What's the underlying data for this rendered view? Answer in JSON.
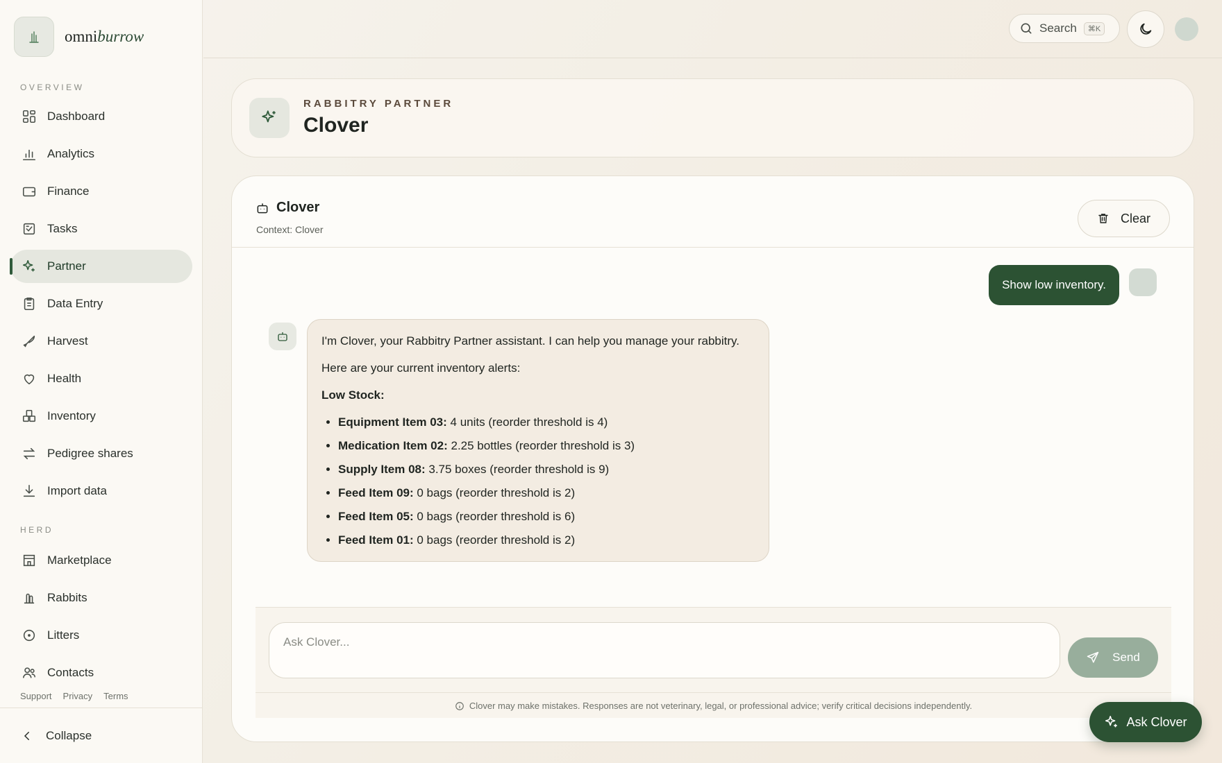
{
  "brand": {
    "name_part1": "omni",
    "name_part2": "burrow"
  },
  "sidebar": {
    "overview_label": "OVERVIEW",
    "herd_label": "HERD",
    "overview_items": [
      {
        "label": "Dashboard",
        "icon": "dashboard-icon"
      },
      {
        "label": "Analytics",
        "icon": "bar-chart-icon"
      },
      {
        "label": "Finance",
        "icon": "wallet-icon"
      },
      {
        "label": "Tasks",
        "icon": "checklist-icon"
      },
      {
        "label": "Partner",
        "icon": "sparkles-icon",
        "active": true
      },
      {
        "label": "Data Entry",
        "icon": "clipboard-icon"
      },
      {
        "label": "Harvest",
        "icon": "knife-icon"
      },
      {
        "label": "Health",
        "icon": "heart-icon"
      },
      {
        "label": "Inventory",
        "icon": "boxes-icon"
      },
      {
        "label": "Pedigree shares",
        "icon": "transfer-icon"
      },
      {
        "label": "Import data",
        "icon": "download-icon"
      }
    ],
    "herd_items": [
      {
        "label": "Marketplace",
        "icon": "store-icon"
      },
      {
        "label": "Rabbits",
        "icon": "rabbit-icon"
      },
      {
        "label": "Litters",
        "icon": "egg-icon"
      },
      {
        "label": "Contacts",
        "icon": "users-icon"
      }
    ],
    "footer_links": [
      "Support",
      "Privacy",
      "Terms"
    ],
    "collapse_label": "Collapse",
    "accent": "#2f5a3a"
  },
  "topbar": {
    "search_label": "Search",
    "search_shortcut": "⌘K"
  },
  "header": {
    "kicker": "RABBITRY PARTNER",
    "title": "Clover"
  },
  "chat": {
    "title": "Clover",
    "context": "Context: Clover",
    "clear_label": "Clear",
    "user_message": "Show low inventory.",
    "assistant": {
      "intro": "I'm Clover, your Rabbitry Partner assistant. I can help you manage your rabbitry.",
      "alerts_intro": "Here are your current inventory alerts:",
      "low_stock_heading": "Low Stock:",
      "items": [
        {
          "name": "Equipment Item 03:",
          "detail": " 4 units (reorder threshold is 4)"
        },
        {
          "name": "Medication Item 02:",
          "detail": " 2.25 bottles (reorder threshold is 3)"
        },
        {
          "name": "Supply Item 08:",
          "detail": " 3.75 boxes (reorder threshold is 9)"
        },
        {
          "name": "Feed Item 09:",
          "detail": " 0 bags (reorder threshold is 2)"
        },
        {
          "name": "Feed Item 05:",
          "detail": " 0 bags (reorder threshold is 6)"
        },
        {
          "name": "Feed Item 01:",
          "detail": " 0 bags (reorder threshold is 2)"
        }
      ]
    },
    "input_placeholder": "Ask Clover...",
    "send_label": "Send",
    "disclaimer": "Clover may make mistakes. Responses are not veterinary, legal, or professional advice; verify critical decisions independently."
  },
  "fab": {
    "label": "Ask Clover"
  },
  "colors": {
    "primary": "#2c5233",
    "send_disabled": "#98ae9c",
    "assistant_bubble": "#f3ece2"
  }
}
